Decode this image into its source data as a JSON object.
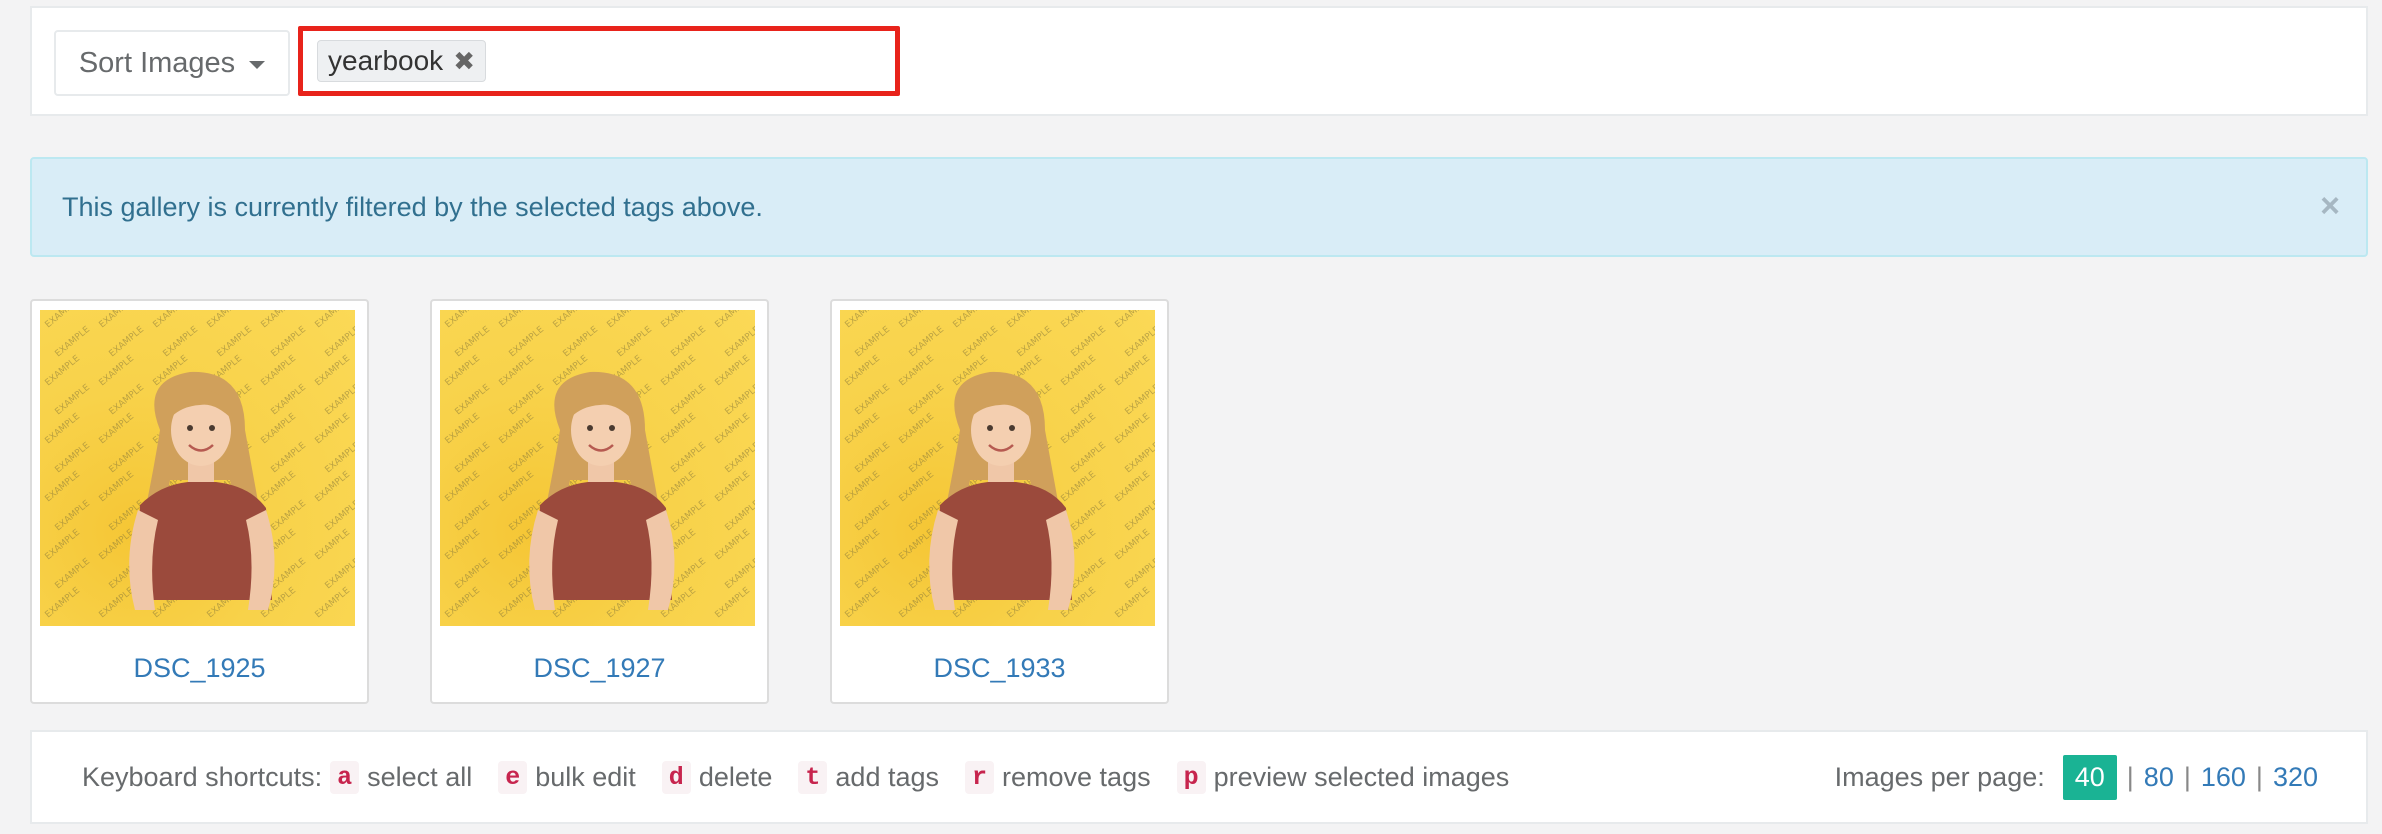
{
  "toolbar": {
    "sort_label": "Sort Images",
    "tags": [
      {
        "label": "yearbook"
      }
    ]
  },
  "alert": {
    "message": "This gallery is currently filtered by the selected tags above.",
    "close_glyph": "×"
  },
  "gallery": {
    "images": [
      {
        "label": "DSC_1925"
      },
      {
        "label": "DSC_1927"
      },
      {
        "label": "DSC_1933"
      }
    ],
    "watermark_text": "EXAMPLE"
  },
  "footer": {
    "shortcuts_label": "Keyboard shortcuts:",
    "shortcuts": [
      {
        "key": "a",
        "label": "select all"
      },
      {
        "key": "e",
        "label": "bulk edit"
      },
      {
        "key": "d",
        "label": "delete"
      },
      {
        "key": "t",
        "label": "add tags"
      },
      {
        "key": "r",
        "label": "remove tags"
      },
      {
        "key": "p",
        "label": "preview selected images"
      }
    ],
    "per_page_label": "Images per page:",
    "per_page_options": [
      "40",
      "80",
      "160",
      "320"
    ],
    "per_page_selected": "40",
    "separator": "|"
  },
  "colors": {
    "accent": "#1ab394",
    "link": "#337ab7",
    "highlight_border": "#e8231b",
    "alert_bg": "#d9edf7",
    "photo_bg": "#f8d24a",
    "shirt": "#9b4a3c",
    "hair": "#d0a05b"
  }
}
